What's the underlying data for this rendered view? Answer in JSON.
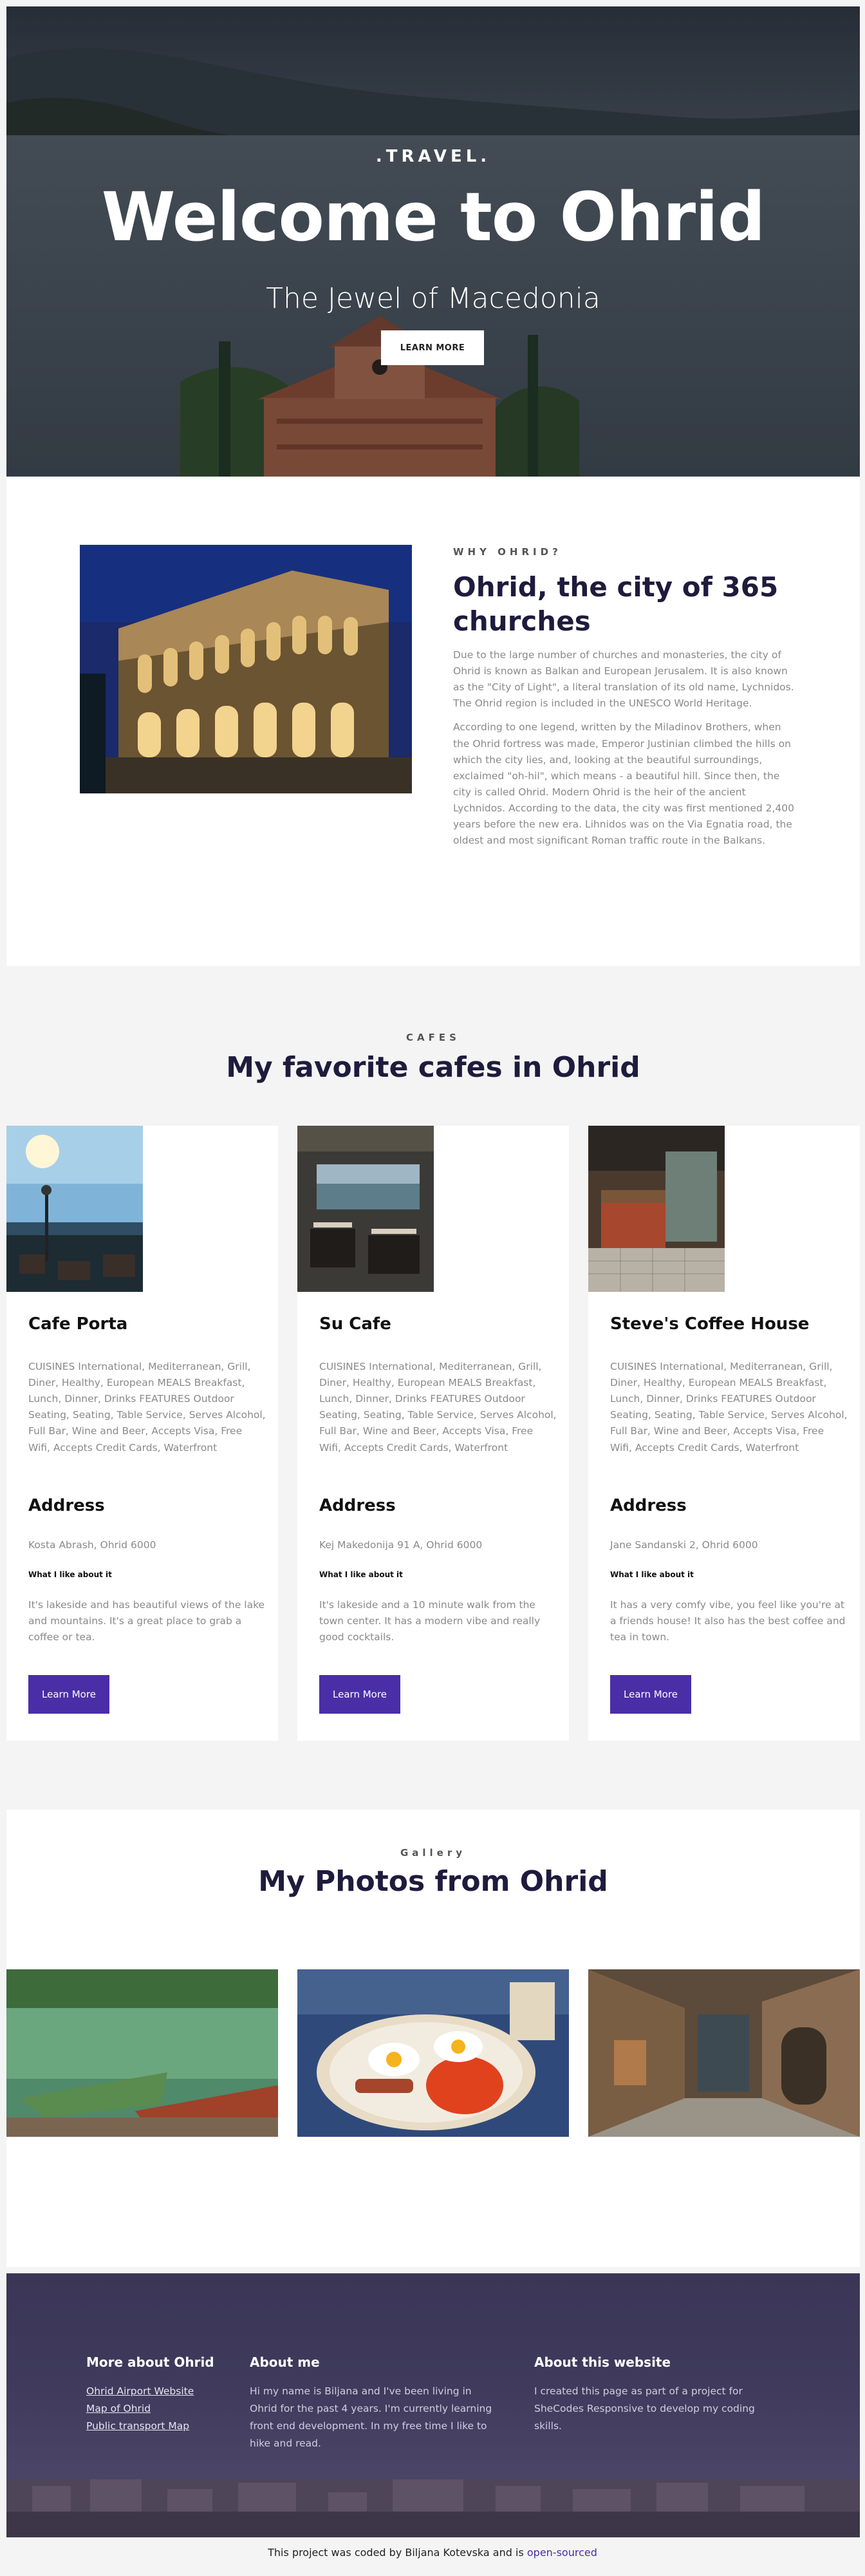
{
  "hero": {
    "eyebrow": ".TRAVEL.",
    "title": "Welcome to Ohrid",
    "subtitle": "The Jewel of Macedonia",
    "button": "LEARN MORE"
  },
  "about": {
    "eyebrow": "WHY OHRID?",
    "title": "Ohrid, the city of 365 churches",
    "paragraphs": [
      "Due to the large number of churches and monasteries, the city of Ohrid is known as Balkan and European Jerusalem. It is also known as the \"City of Light\", a literal translation of its old name, Lychnidos. The Ohrid region is included in the UNESCO World Heritage.",
      "According to one legend, written by the Miladinov Brothers, when the Ohrid fortress was made, Emperor Justinian climbed the hills on which the city lies, and, looking at the beautiful surroundings, exclaimed \"oh-hil\", which means - a beautiful hill. Since then, the city is called Ohrid. Modern Ohrid is the heir of the ancient Lychnidos. According to the data, the city was first mentioned 2,400 years before the new era. Lihnidos was on the Via Egnatia road, the oldest and most significant Roman traffic route in the Balkans."
    ]
  },
  "cafes": {
    "eyebrow": "CAFES",
    "title": "My favorite cafes in Ohrid",
    "items": [
      {
        "name": "Cafe Porta",
        "features": "CUISINES International, Mediterranean, Grill, Diner, Healthy, European MEALS Breakfast, Lunch, Dinner, Drinks FEATURES Outdoor Seating, Seating, Table Service, Serves Alcohol, Full Bar, Wine and Beer, Accepts Visa, Free Wifi, Accepts Credit Cards, Waterfront",
        "address_heading": "Address",
        "address": "Kosta Abrash, Ohrid 6000",
        "like_heading": "What I like about it",
        "like": "It's lakeside and has beautiful views of the lake and mountains. It's a great place to grab a coffee or tea.",
        "button": "Learn More"
      },
      {
        "name": "Su Cafe",
        "features": "CUISINES International, Mediterranean, Grill, Diner, Healthy, European MEALS Breakfast, Lunch, Dinner, Drinks FEATURES Outdoor Seating, Seating, Table Service, Serves Alcohol, Full Bar, Wine and Beer, Accepts Visa, Free Wifi, Accepts Credit Cards, Waterfront",
        "address_heading": "Address",
        "address": "Kej Makedonija 91 A, Ohrid 6000",
        "like_heading": "What I like about it",
        "like": "It's lakeside and a 10 minute walk from the town center. It has a modern vibe and really good cocktails.",
        "button": "Learn More"
      },
      {
        "name": "Steve's Coffee House",
        "features": "CUISINES International, Mediterranean, Grill, Diner, Healthy, European MEALS Breakfast, Lunch, Dinner, Drinks FEATURES Outdoor Seating, Seating, Table Service, Serves Alcohol, Full Bar, Wine and Beer, Accepts Visa, Free Wifi, Accepts Credit Cards, Waterfront",
        "address_heading": "Address",
        "address": "Jane Sandanski 2, Ohrid 6000",
        "like_heading": "What I like about it",
        "like": "It has a very comfy vibe, you feel like you're at a friends house! It also has the best coffee and tea in town.",
        "button": "Learn More"
      }
    ]
  },
  "gallery": {
    "eyebrow": "Gallery",
    "title": "My Photos from Ohrid"
  },
  "footer": {
    "col1": {
      "heading": "More about Ohrid",
      "links": [
        "Ohrid Airport Website",
        "Map of Ohrid",
        "Public transport Map"
      ]
    },
    "col2": {
      "heading": "About me",
      "text": "Hi my name is Biljana and I've been living in Ohrid for the past 4 years. I'm currently learning front end development. In my free time I like to hike and read."
    },
    "col3": {
      "heading": "About this website",
      "text": "I created this page as part of a project for SheCodes Responsive to develop my coding skills."
    }
  },
  "credit": {
    "text": "This project was coded by Biljana Kotevska and is",
    "link": "open-sourced"
  },
  "colors": {
    "accent": "#4a2ea8",
    "heading": "#1f1b3d",
    "body_text": "#8a8a8a"
  }
}
